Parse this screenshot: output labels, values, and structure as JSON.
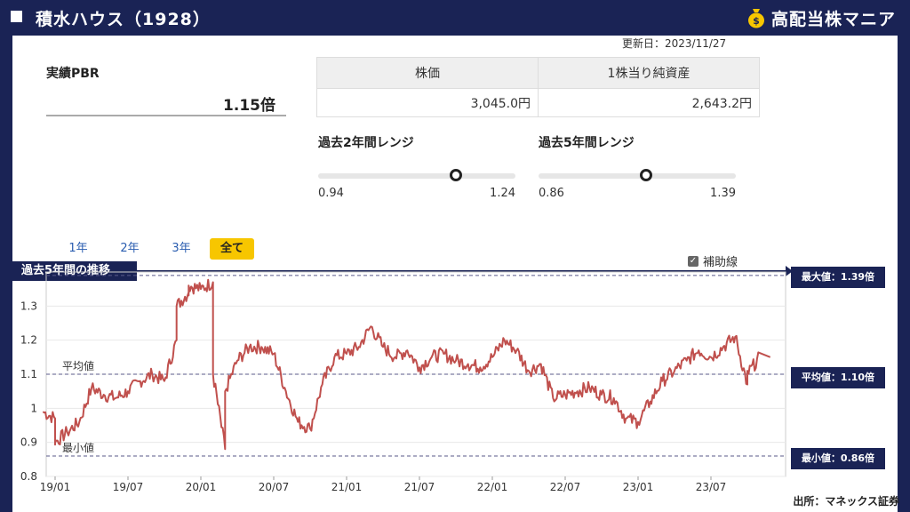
{
  "header": {
    "title": "積水ハウス（1928）",
    "logo_text": "高配当株マニア"
  },
  "updated": "更新日：2023/11/27",
  "pbr": {
    "label": "実績PBR",
    "value": "1.15倍"
  },
  "table": {
    "headers": [
      "株価",
      "1株当り純資産"
    ],
    "values": [
      "3,045.0円",
      "2,643.2円"
    ]
  },
  "ranges": [
    {
      "title": "過去2年間レンジ",
      "min": "0.94",
      "max": "1.24",
      "current": 1.15
    },
    {
      "title": "過去5年間レンジ",
      "min": "0.86",
      "max": "1.39",
      "current": 1.15
    }
  ],
  "period_tabs": [
    {
      "label": "1年",
      "active": false
    },
    {
      "label": "2年",
      "active": false
    },
    {
      "label": "3年",
      "active": false
    },
    {
      "label": "全て",
      "active": true
    }
  ],
  "aux_line": {
    "label": "補助線",
    "checked": true
  },
  "chart_badge": "過去5年間の推移",
  "ref_labels": {
    "avg": "平均値",
    "min": "最小値"
  },
  "right_labels": {
    "max": "最大値：1.39倍",
    "avg": "平均値：1.10倍",
    "min": "最小値：0.86倍"
  },
  "source": "出所：マネックス証券",
  "chart_data": {
    "type": "line",
    "title": "",
    "xlabel": "",
    "ylabel": "",
    "ylim": [
      0.8,
      1.4
    ],
    "y_ticks": [
      "0.8",
      "0.9",
      "1",
      "1.1",
      "1.2",
      "1.3"
    ],
    "x_ticks": [
      "19/01",
      "19/07",
      "20/01",
      "20/07",
      "21/01",
      "21/07",
      "22/01",
      "22/07",
      "23/01",
      "23/07"
    ],
    "reference_lines": {
      "max": 1.39,
      "avg": 1.1,
      "min": 0.86
    },
    "line_color": "#c0504d",
    "x": [
      "2018-12",
      "2019-01",
      "2019-01",
      "2019-02",
      "2019-03",
      "2019-04",
      "2019-05",
      "2019-06",
      "2019-07",
      "2019-08",
      "2019-09",
      "2019-10",
      "2019-11",
      "2019-11",
      "2019-12",
      "2019-12",
      "2020-01",
      "2020-02",
      "2020-02",
      "2020-03",
      "2020-03",
      "2020-04",
      "2020-05",
      "2020-06",
      "2020-07",
      "2020-08",
      "2020-09",
      "2020-10",
      "2020-11",
      "2020-12",
      "2021-01",
      "2021-02",
      "2021-03",
      "2021-04",
      "2021-05",
      "2021-06",
      "2021-07",
      "2021-08",
      "2021-09",
      "2021-10",
      "2021-11",
      "2021-12",
      "2022-01",
      "2022-02",
      "2022-03",
      "2022-04",
      "2022-05",
      "2022-06",
      "2022-07",
      "2022-08",
      "2022-09",
      "2022-10",
      "2022-11",
      "2022-12",
      "2023-01",
      "2023-02",
      "2023-03",
      "2023-04",
      "2023-05",
      "2023-06",
      "2023-07",
      "2023-08",
      "2023-09",
      "2023-10",
      "2023-10",
      "2023-11"
    ],
    "values": [
      0.99,
      0.97,
      0.9,
      0.93,
      0.96,
      1.06,
      1.04,
      1.03,
      1.05,
      1.08,
      1.1,
      1.08,
      1.2,
      1.3,
      1.34,
      1.36,
      1.35,
      1.37,
      1.1,
      0.88,
      1.05,
      1.14,
      1.18,
      1.18,
      1.16,
      1.05,
      0.96,
      0.94,
      1.07,
      1.15,
      1.16,
      1.18,
      1.24,
      1.18,
      1.15,
      1.17,
      1.12,
      1.15,
      1.16,
      1.14,
      1.13,
      1.12,
      1.15,
      1.2,
      1.17,
      1.11,
      1.13,
      1.03,
      1.04,
      1.05,
      1.06,
      1.04,
      1.03,
      0.97,
      0.96,
      1.02,
      1.08,
      1.11,
      1.14,
      1.17,
      1.15,
      1.18,
      1.21,
      1.07,
      1.1,
      1.15
    ]
  }
}
